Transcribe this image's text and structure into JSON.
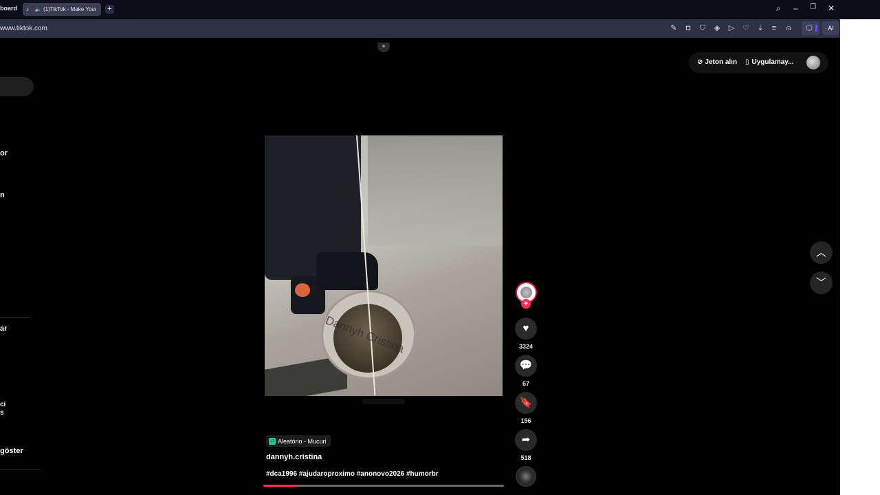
{
  "browser": {
    "prev_tab_label": "board",
    "active_tab_title": "(1)TikTok - Make Your",
    "new_tab_icon": "plus-icon",
    "url": "www.tiktok.com",
    "ai_label": "AI"
  },
  "header": {
    "coins_label": "Jeton alın",
    "app_label": "Uygulamay..."
  },
  "sidebar": {
    "items": [
      "or",
      "n",
      "ar",
      "ci",
      "s",
      "göster"
    ]
  },
  "video": {
    "watermark": "Dannyh Cristina",
    "progress": 0.14
  },
  "actions": {
    "likes": "3324",
    "comments": "67",
    "saves": "156",
    "shares": "518"
  },
  "caption": {
    "music": "Aleatório - Mucuri",
    "username": "dannyh.cristina",
    "hashtags": "#dca1996 #ajudaroproximo #anonovo2026 #humorbr"
  },
  "colors": {
    "accent": "#fe2c55",
    "background": "#000000"
  }
}
